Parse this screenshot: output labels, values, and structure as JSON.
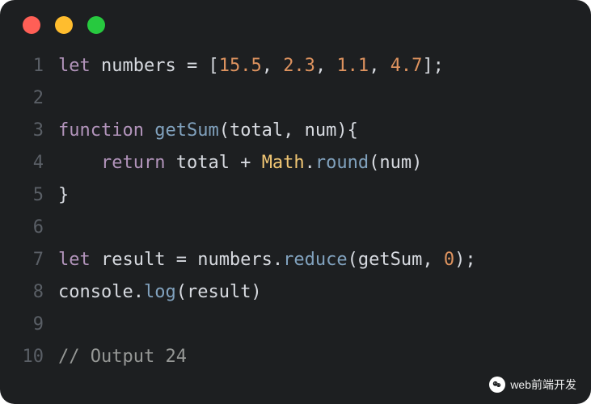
{
  "gutter": [
    "1",
    "2",
    "3",
    "4",
    "5",
    "6",
    "7",
    "8",
    "9",
    "10"
  ],
  "lines": [
    [
      {
        "cls": "kw",
        "t": "let"
      },
      {
        "cls": "punct",
        "t": " "
      },
      {
        "cls": "ident",
        "t": "numbers"
      },
      {
        "cls": "punct",
        "t": " = ["
      },
      {
        "cls": "num",
        "t": "15.5"
      },
      {
        "cls": "punct",
        "t": ", "
      },
      {
        "cls": "num",
        "t": "2.3"
      },
      {
        "cls": "punct",
        "t": ", "
      },
      {
        "cls": "num",
        "t": "1.1"
      },
      {
        "cls": "punct",
        "t": ", "
      },
      {
        "cls": "num",
        "t": "4.7"
      },
      {
        "cls": "punct",
        "t": "];"
      }
    ],
    [],
    [
      {
        "cls": "kw",
        "t": "function"
      },
      {
        "cls": "punct",
        "t": " "
      },
      {
        "cls": "fname",
        "t": "getSum"
      },
      {
        "cls": "punct",
        "t": "(total, num){"
      }
    ],
    [
      {
        "cls": "punct",
        "t": "    "
      },
      {
        "cls": "kw",
        "t": "return"
      },
      {
        "cls": "punct",
        "t": " total + "
      },
      {
        "cls": "cls",
        "t": "Math"
      },
      {
        "cls": "punct",
        "t": "."
      },
      {
        "cls": "fcall",
        "t": "round"
      },
      {
        "cls": "punct",
        "t": "(num)"
      }
    ],
    [
      {
        "cls": "punct",
        "t": "}"
      }
    ],
    [],
    [
      {
        "cls": "kw",
        "t": "let"
      },
      {
        "cls": "punct",
        "t": " result = numbers."
      },
      {
        "cls": "fcall",
        "t": "reduce"
      },
      {
        "cls": "punct",
        "t": "(getSum, "
      },
      {
        "cls": "num",
        "t": "0"
      },
      {
        "cls": "punct",
        "t": ");"
      }
    ],
    [
      {
        "cls": "ident",
        "t": "console"
      },
      {
        "cls": "punct",
        "t": "."
      },
      {
        "cls": "fcall",
        "t": "log"
      },
      {
        "cls": "punct",
        "t": "(result)"
      }
    ],
    [],
    [
      {
        "cls": "comment",
        "t": "// Output 24"
      }
    ]
  ],
  "watermark_text": "web前端开发"
}
